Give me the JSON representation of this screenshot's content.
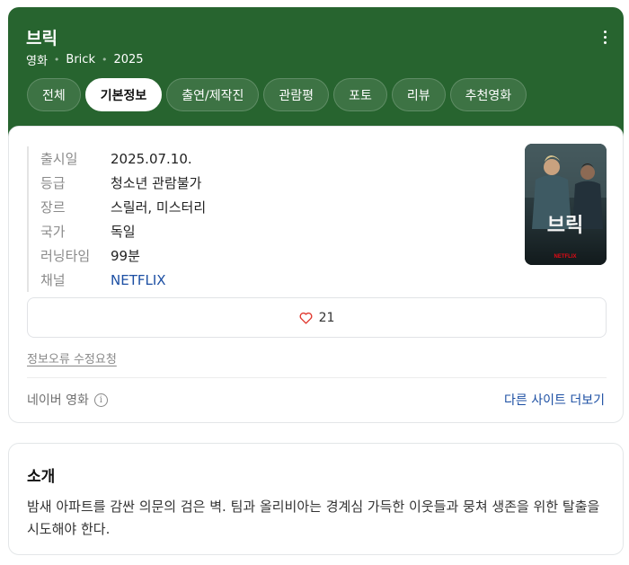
{
  "header": {
    "title": "브릭",
    "meta": [
      "영화",
      "Brick",
      "2025"
    ]
  },
  "tabs": [
    {
      "label": "전체",
      "active": false
    },
    {
      "label": "기본정보",
      "active": true
    },
    {
      "label": "출연/제작진",
      "active": false
    },
    {
      "label": "관람평",
      "active": false
    },
    {
      "label": "포토",
      "active": false
    },
    {
      "label": "리뷰",
      "active": false
    },
    {
      "label": "추천영화",
      "active": false
    }
  ],
  "info": [
    {
      "label": "출시일",
      "value": "2025.07.10."
    },
    {
      "label": "등급",
      "value": "청소년 관람불가"
    },
    {
      "label": "장르",
      "value": "스릴러, 미스터리"
    },
    {
      "label": "국가",
      "value": "독일"
    },
    {
      "label": "러닝타임",
      "value": "99분"
    },
    {
      "label": "채널",
      "value": "NETFLIX"
    }
  ],
  "poster": {
    "title_text": "브릭",
    "badge_text": "NETFLIX"
  },
  "likes": {
    "count": "21",
    "icon": "heart-icon"
  },
  "report_link": "정보오류 수정요청",
  "source": {
    "label": "네이버 영화",
    "icon": "info-icon"
  },
  "other_sites": "다른 사이트 더보기",
  "intro": {
    "title": "소개",
    "text": "밤새 아파트를 감싼 의문의 검은 벽. 팀과 올리비아는 경계심 가득한 이웃들과 뭉쳐 생존을 위한 탈출을 시도해야 한다."
  },
  "colors": {
    "header_bg": "#27642f",
    "link": "#1c4fa3",
    "heart": "#e0352b"
  }
}
